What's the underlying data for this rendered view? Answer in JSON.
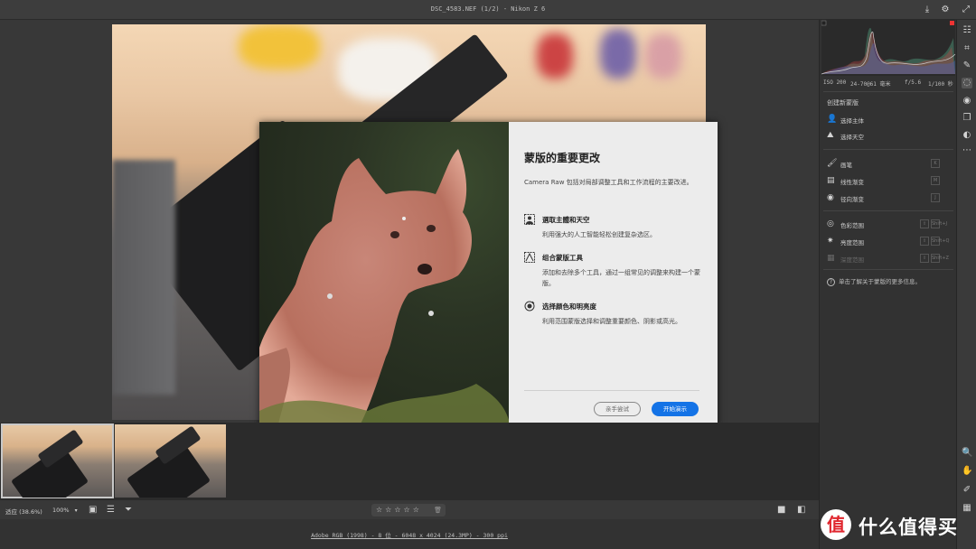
{
  "window": {
    "title": "DSC_4583.NEF (1/2)  -  Nikon Z 6"
  },
  "dialog": {
    "title": "蒙版的重要更改",
    "intro": "Camera Raw 包括对局部调整工具和工作流程的主要改进。",
    "features": [
      {
        "icon": "select-subject-icon",
        "title": "選取主體和天空",
        "desc": "利用强大的人工智能轻松创建复杂选区。"
      },
      {
        "icon": "combine-mask-icon",
        "title": "组合蒙版工具",
        "desc": "添加和去除多个工具，通过一组常见的调整来构建一个蒙版。"
      },
      {
        "icon": "color-range-icon",
        "title": "选择颜色和明亮度",
        "desc": "利用范围蒙版选择和调整重要颜色、阴影或高光。"
      }
    ],
    "try_button": "亲手尝试",
    "demo_button": "开始演示"
  },
  "statusbar": {
    "fit_label": "适应 (38.6%)",
    "zoom_value": "100%",
    "rating_stars": "☆☆☆☆☆",
    "file_info": "Adobe RGB (1998) - 8 位 - 6048 x 4024 (24.3MP) - 300 ppi"
  },
  "filmstrip": {
    "selected_index": 0,
    "count": 2
  },
  "right_panel": {
    "meta": {
      "iso": "ISO 200",
      "lens": "24-70@61 毫米",
      "aperture": "f/5.6",
      "shutter": "1/100 秒"
    },
    "heading": "创建新蒙版",
    "group1": [
      {
        "icon": "subject-icon",
        "label": "选择主体"
      },
      {
        "icon": "sky-icon",
        "label": "选择天空"
      }
    ],
    "group2": [
      {
        "icon": "brush-icon",
        "label": "画笔",
        "key": "K"
      },
      {
        "icon": "linear-gradient-icon",
        "label": "线性渐变",
        "key": "M"
      },
      {
        "icon": "radial-gradient-icon",
        "label": "径向渐变",
        "key": "J"
      }
    ],
    "group3": [
      {
        "icon": "color-range-icon",
        "label": "色彩范围",
        "key": "Shift+J"
      },
      {
        "icon": "luminance-range-icon",
        "label": "亮度范围",
        "key": "Shift+Q"
      },
      {
        "icon": "depth-range-icon",
        "label": "深度范围",
        "key": "Shift+Z",
        "disabled": true
      }
    ],
    "help_text": "单击了解关于蒙版的更多信息。"
  },
  "watermark": {
    "badge": "值",
    "text": "什么值得买"
  },
  "colors": {
    "accent": "#1473e6",
    "panel_bg": "#323232",
    "dialog_bg": "#ececec"
  }
}
